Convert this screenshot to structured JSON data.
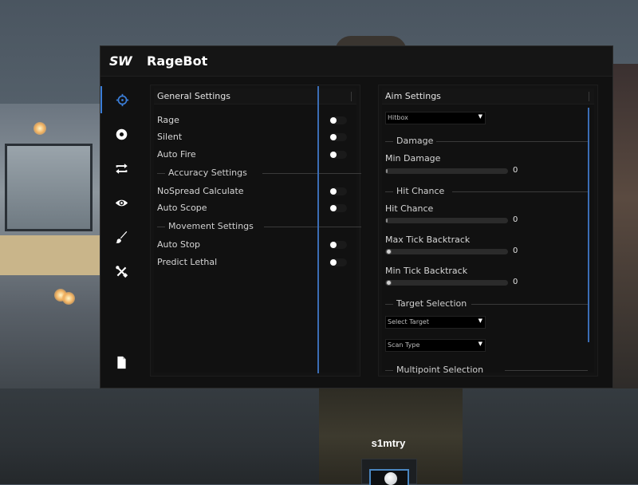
{
  "app": {
    "logo": "SW",
    "title": "RageBot"
  },
  "sidebar": {
    "items": [
      {
        "icon": "crosshair-icon",
        "active": true
      },
      {
        "icon": "record-icon",
        "active": false
      },
      {
        "icon": "repeat-icon",
        "active": false
      },
      {
        "icon": "eye-icon",
        "active": false
      },
      {
        "icon": "brush-icon",
        "active": false
      },
      {
        "icon": "tools-icon",
        "active": false
      },
      {
        "icon": "file-icon",
        "active": false
      }
    ]
  },
  "general": {
    "title": "General Settings",
    "rage": "Rage",
    "silent": "Silent",
    "auto_fire": "Auto Fire",
    "accuracy_title": "Accuracy Settings",
    "nospread": "NoSpread Calculate",
    "auto_scope": "Auto Scope",
    "movement_title": "Movement Settings",
    "auto_stop": "Auto Stop",
    "predict_lethal": "Predict Lethal"
  },
  "aim": {
    "title": "Aim Settings",
    "hitbox_dropdown": "Hitbox",
    "damage_title": "Damage",
    "min_damage_label": "Min Damage",
    "min_damage_value": "0",
    "hit_chance_title": "Hit Chance",
    "hit_chance_label": "Hit Chance",
    "hit_chance_value": "0",
    "max_tick_label": "Max Tick Backtrack",
    "max_tick_value": "0",
    "min_tick_label": "Min Tick Backtrack",
    "min_tick_value": "0",
    "target_title": "Target Selection",
    "select_target_dropdown": "Select Target",
    "scan_type_dropdown": "Scan Type",
    "multipoint_title": "Multipoint Selection"
  },
  "overlay": {
    "player_name": "s1mtry"
  },
  "colors": {
    "accent": "#3b7ed8",
    "window_bg": "#111111"
  }
}
